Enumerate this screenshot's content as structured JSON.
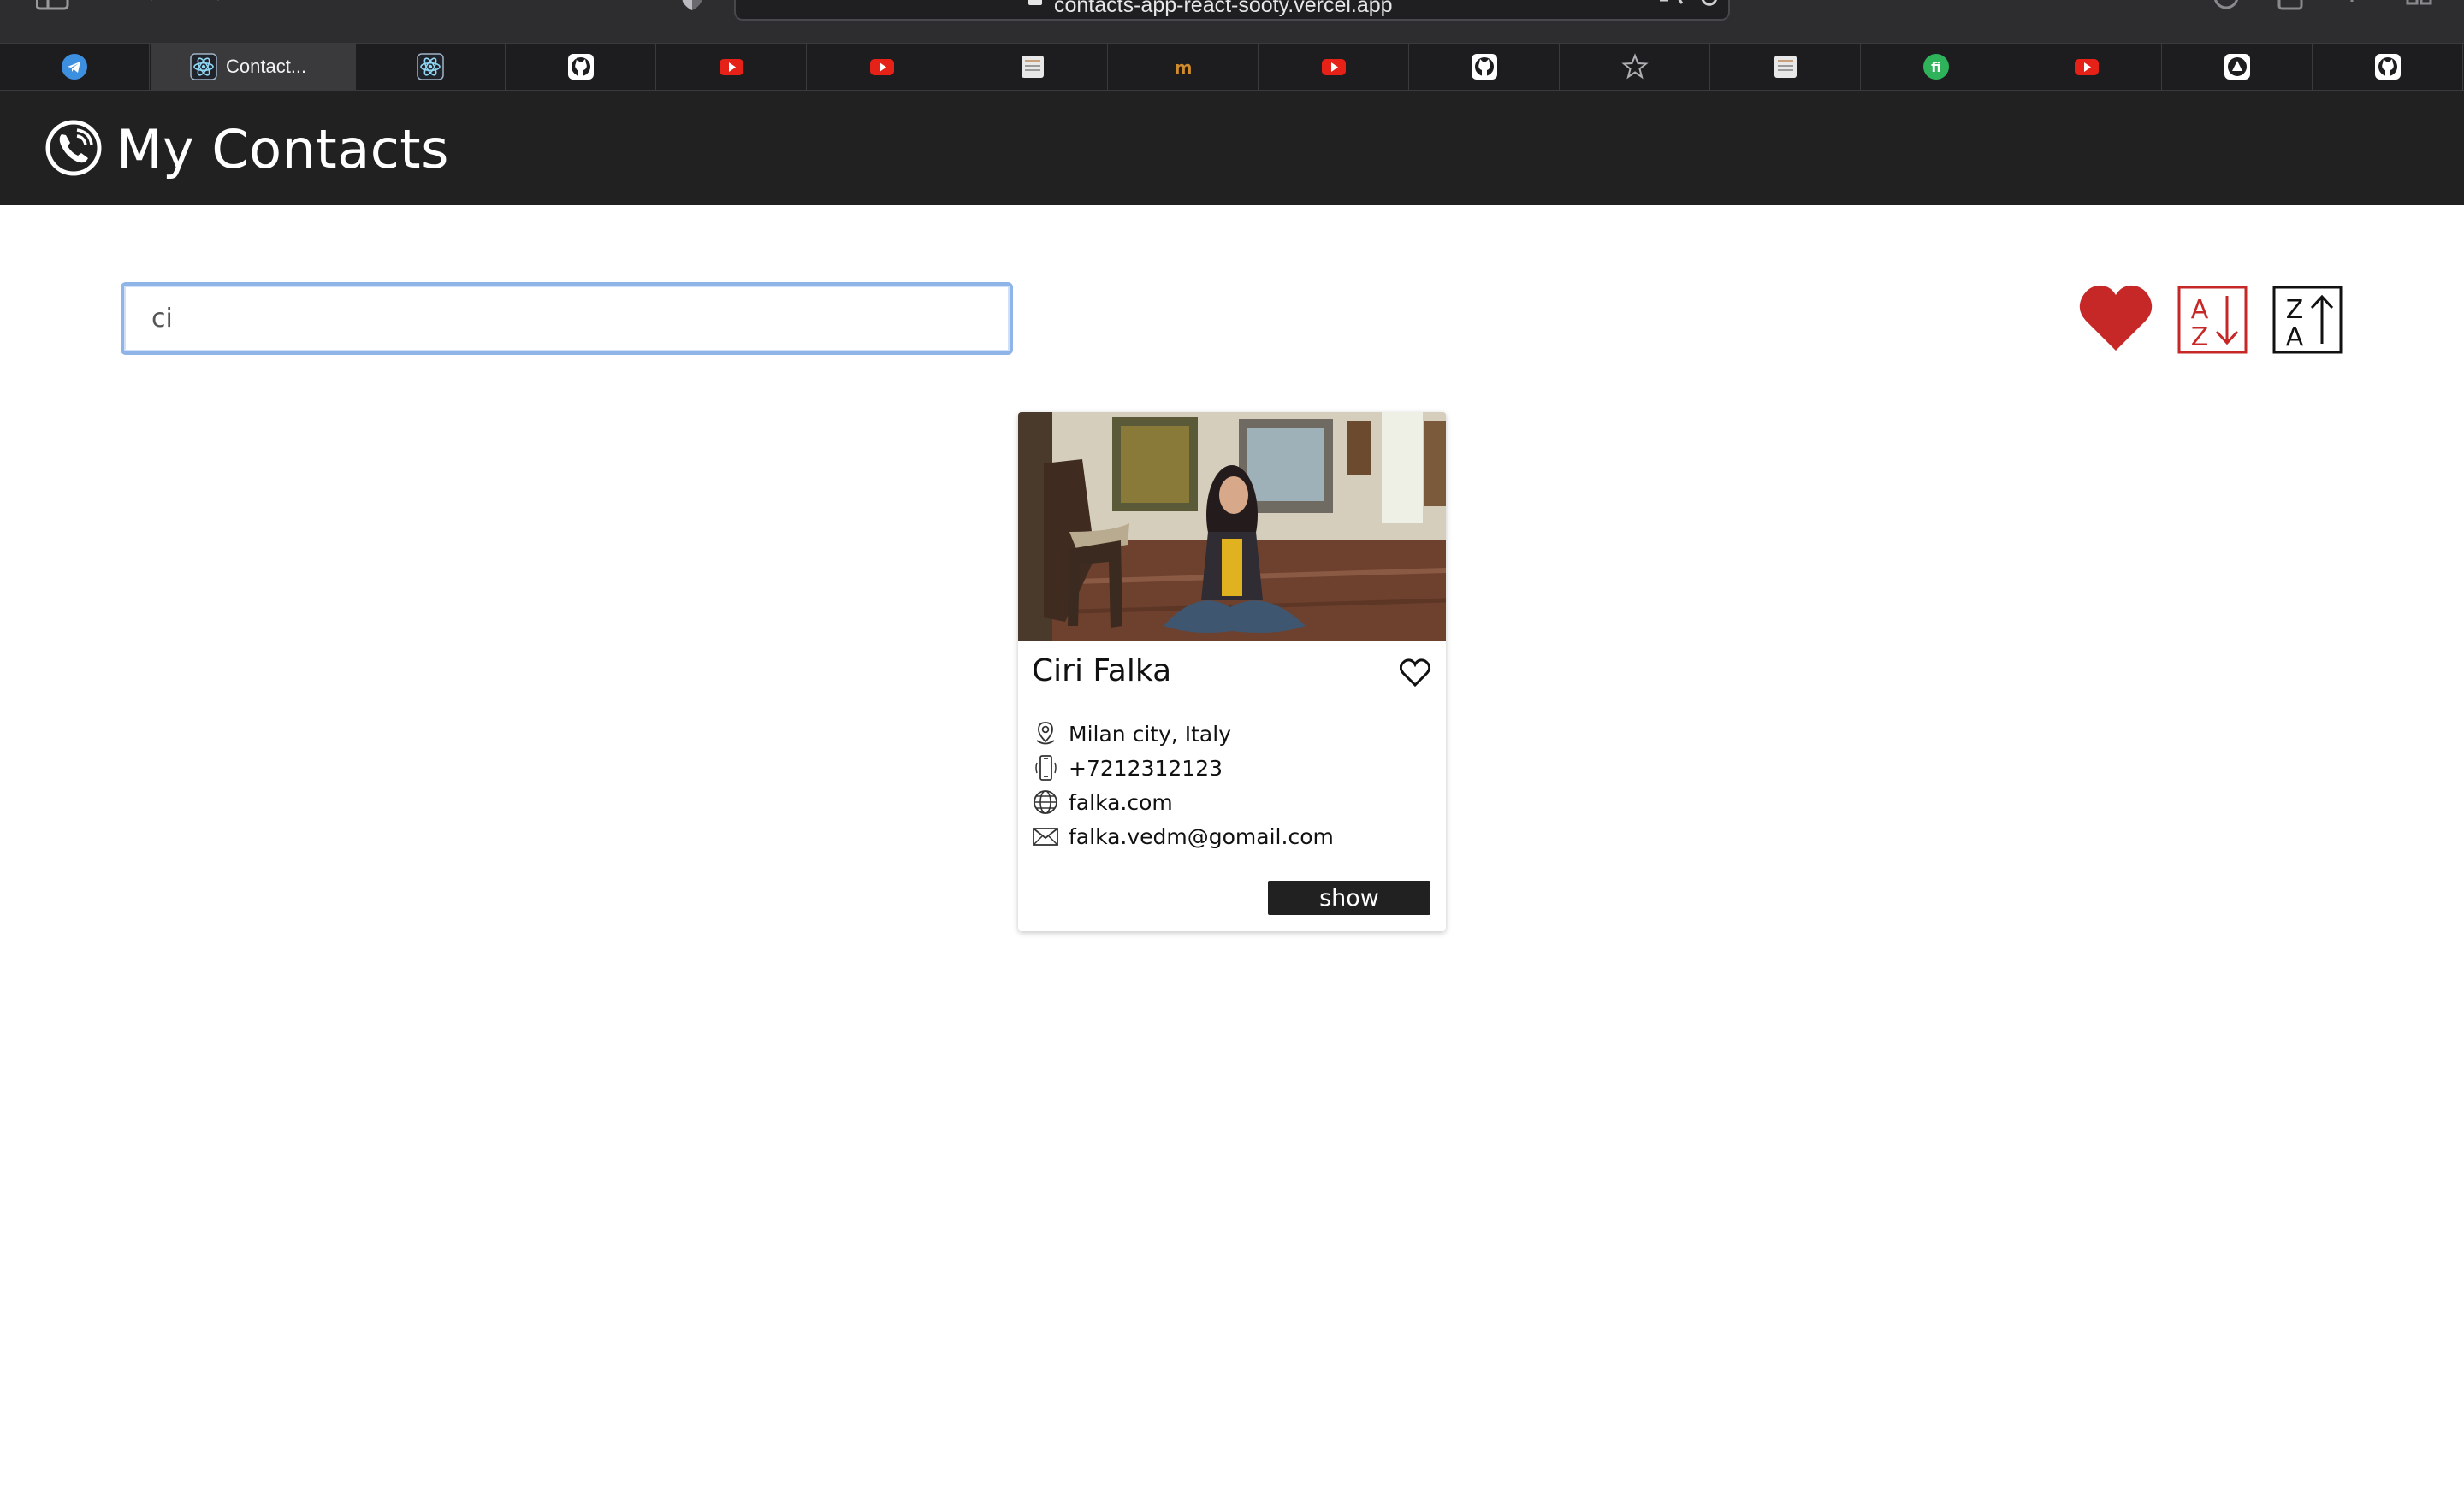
{
  "browser": {
    "url": "contacts-app-react-sooty.vercel.app",
    "tabs": [
      {
        "icon": "telegram-icon",
        "title": ""
      },
      {
        "icon": "react-icon",
        "title": "Contact..."
      },
      {
        "icon": "react-icon",
        "title": ""
      },
      {
        "icon": "github-icon",
        "title": ""
      },
      {
        "icon": "youtube-icon",
        "title": ""
      },
      {
        "icon": "youtube-icon",
        "title": ""
      },
      {
        "icon": "page-icon",
        "title": ""
      },
      {
        "icon": "in-icon",
        "title": ""
      },
      {
        "icon": "youtube-icon",
        "title": ""
      },
      {
        "icon": "github-icon",
        "title": ""
      },
      {
        "icon": "star-icon",
        "title": ""
      },
      {
        "icon": "page-icon",
        "title": ""
      },
      {
        "icon": "fi-icon",
        "title": ""
      },
      {
        "icon": "youtube-icon",
        "title": ""
      },
      {
        "icon": "triangle-icon",
        "title": ""
      },
      {
        "icon": "github-icon",
        "title": ""
      }
    ]
  },
  "header": {
    "title": "My Contacts",
    "icon": "phone-icon"
  },
  "search": {
    "value": "ci"
  },
  "controls": {
    "favorites_filter_icon": "heart-filled-icon",
    "sort_az_icon": "sort-az-icon",
    "sort_za_icon": "sort-za-icon"
  },
  "contacts": [
    {
      "name": "Ciri Falka",
      "location": "Milan city, Italy",
      "phone": "+7212312123",
      "website": "falka.com",
      "email": "falka.vedm@gomail.com",
      "show_label": "show",
      "favorite": false
    }
  ],
  "colors": {
    "header_bg": "#212121",
    "accent_red": "#c62828",
    "search_border": "#8fb5e8"
  }
}
